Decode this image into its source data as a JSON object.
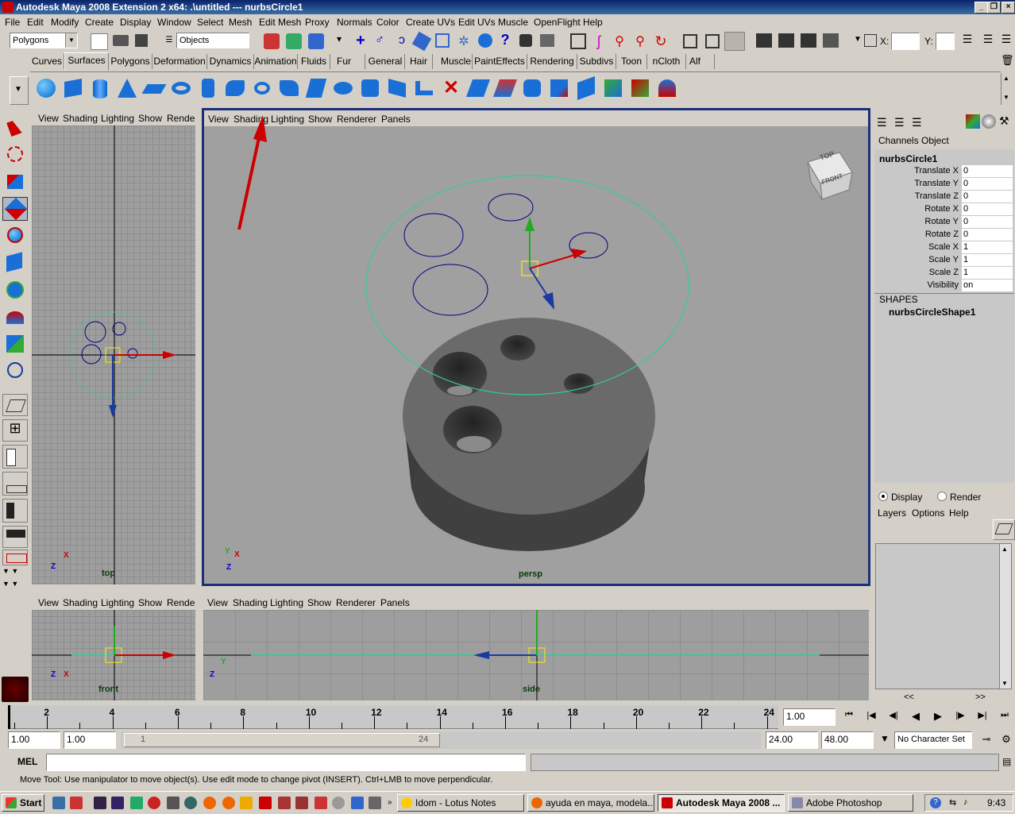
{
  "window": {
    "title": "Autodesk Maya 2008 Extension 2 x64: .\\untitled   ---   nurbsCircle1",
    "buttons": [
      "_",
      "❐",
      "×"
    ]
  },
  "menubar": [
    "File",
    "Edit",
    "Modify",
    "Create",
    "Display",
    "Window",
    "Select",
    "Mesh",
    "Edit Mesh",
    "Proxy",
    "Normals",
    "Color",
    "Create UVs",
    "Edit UVs",
    "Muscle",
    "OpenFlight",
    "Help"
  ],
  "toolbar": {
    "mode_menu": "Polygons",
    "selection_field": "Objects",
    "x_label": "X:",
    "y_label": "Y:",
    "x_value": "",
    "y_value": ""
  },
  "shelf_tabs": [
    "Curves",
    "Surfaces",
    "Polygons",
    "Deformation",
    "Dynamics",
    "Animation",
    "Fluids",
    "Fur",
    "General",
    "Hair",
    "Muscle",
    "PaintEffects",
    "Rendering",
    "Subdivs",
    "Toon",
    "nCloth",
    "Alf"
  ],
  "active_shelf": "Surfaces",
  "viewport_menu": [
    "View",
    "Shading",
    "Lighting",
    "Show",
    "Renderer",
    "Panels"
  ],
  "viewport_menu_short": [
    "View",
    "Shading",
    "Lighting",
    "Show",
    "Render"
  ],
  "viewports": {
    "top": "top",
    "persp": "persp",
    "front": "front",
    "side": "side"
  },
  "axes": {
    "x": "X",
    "y": "Y",
    "z": "Z"
  },
  "viewcube": {
    "top": "TOP",
    "front": "FRONT"
  },
  "channelbox": {
    "tabs": [
      "Channels",
      "Object"
    ],
    "object_name": "nurbsCircle1",
    "attributes": [
      {
        "name": "Translate X",
        "value": "0"
      },
      {
        "name": "Translate Y",
        "value": "0"
      },
      {
        "name": "Translate Z",
        "value": "0"
      },
      {
        "name": "Rotate X",
        "value": "0"
      },
      {
        "name": "Rotate Y",
        "value": "0"
      },
      {
        "name": "Rotate Z",
        "value": "0"
      },
      {
        "name": "Scale X",
        "value": "1"
      },
      {
        "name": "Scale Y",
        "value": "1"
      },
      {
        "name": "Scale Z",
        "value": "1"
      },
      {
        "name": "Visibility",
        "value": "on"
      }
    ],
    "shapes_header": "SHAPES",
    "shape_name": "nurbsCircleShape1"
  },
  "layer_editor": {
    "display_label": "Display",
    "render_label": "Render",
    "menu": [
      "Layers",
      "Options",
      "Help"
    ],
    "scroll_left": "<<",
    "scroll_right": ">>"
  },
  "timeslider": {
    "labels": [
      "2",
      "4",
      "6",
      "8",
      "10",
      "12",
      "14",
      "16",
      "18",
      "20",
      "22",
      "24"
    ],
    "current_frame": "1.00"
  },
  "range": {
    "start": "1.00",
    "playback_start": "1.00",
    "slider_start": "1",
    "slider_end": "24",
    "playback_end": "24.00",
    "end": "48.00",
    "character_set": "No Character Set"
  },
  "command_line": {
    "label": "MEL",
    "value": ""
  },
  "help_line": "Move Tool: Use manipulator to move object(s). Use edit mode to change pivot (INSERT).  Ctrl+LMB to move perpendicular.",
  "taskbar": {
    "start": "Start",
    "tasks": [
      {
        "label": "Idom - Lotus Notes",
        "active": false
      },
      {
        "label": "ayuda en maya, modela...",
        "active": false
      },
      {
        "label": "Autodesk Maya 2008 ...",
        "active": true
      },
      {
        "label": "Adobe Photoshop",
        "active": false
      }
    ],
    "clock": "9:43"
  },
  "colors": {
    "title_bar": "#0a246a",
    "viewport_bg": "#a0a0a0",
    "selected_curve": "#33cc99",
    "curve": "#000080",
    "annotation_arrow": "#cc0000",
    "active_panel_border": "#1c2f78"
  }
}
